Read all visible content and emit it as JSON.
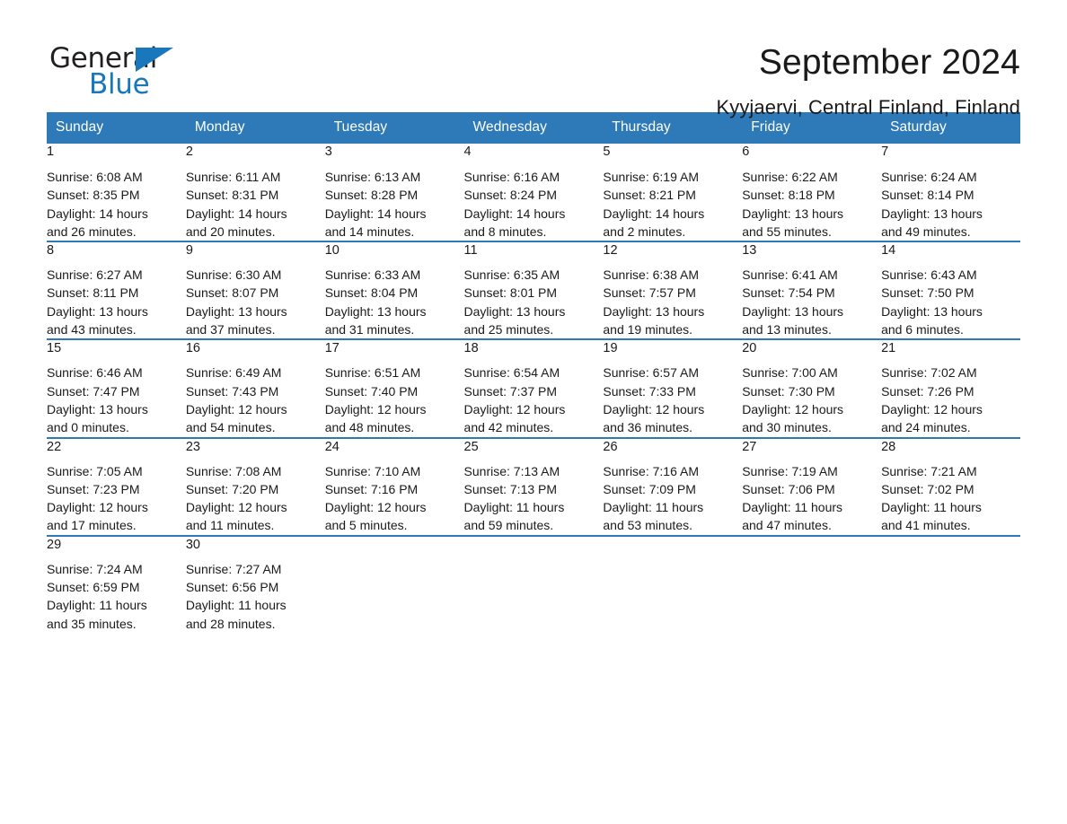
{
  "brand": {
    "name_part1": "General",
    "name_part2": "Blue",
    "accent_color": "#1877bd"
  },
  "header": {
    "title": "September 2024",
    "subtitle": "Kyyjaervi, Central Finland, Finland"
  },
  "colors": {
    "header_blue": "#2e7ab8",
    "daynum_band": "#f2f2f2",
    "text": "#1a1a1a"
  },
  "weekday_headers": [
    "Sunday",
    "Monday",
    "Tuesday",
    "Wednesday",
    "Thursday",
    "Friday",
    "Saturday"
  ],
  "weeks": [
    [
      {
        "day": "1",
        "sunrise": "Sunrise: 6:08 AM",
        "sunset": "Sunset: 8:35 PM",
        "daylight_1": "Daylight: 14 hours",
        "daylight_2": "and 26 minutes."
      },
      {
        "day": "2",
        "sunrise": "Sunrise: 6:11 AM",
        "sunset": "Sunset: 8:31 PM",
        "daylight_1": "Daylight: 14 hours",
        "daylight_2": "and 20 minutes."
      },
      {
        "day": "3",
        "sunrise": "Sunrise: 6:13 AM",
        "sunset": "Sunset: 8:28 PM",
        "daylight_1": "Daylight: 14 hours",
        "daylight_2": "and 14 minutes."
      },
      {
        "day": "4",
        "sunrise": "Sunrise: 6:16 AM",
        "sunset": "Sunset: 8:24 PM",
        "daylight_1": "Daylight: 14 hours",
        "daylight_2": "and 8 minutes."
      },
      {
        "day": "5",
        "sunrise": "Sunrise: 6:19 AM",
        "sunset": "Sunset: 8:21 PM",
        "daylight_1": "Daylight: 14 hours",
        "daylight_2": "and 2 minutes."
      },
      {
        "day": "6",
        "sunrise": "Sunrise: 6:22 AM",
        "sunset": "Sunset: 8:18 PM",
        "daylight_1": "Daylight: 13 hours",
        "daylight_2": "and 55 minutes."
      },
      {
        "day": "7",
        "sunrise": "Sunrise: 6:24 AM",
        "sunset": "Sunset: 8:14 PM",
        "daylight_1": "Daylight: 13 hours",
        "daylight_2": "and 49 minutes."
      }
    ],
    [
      {
        "day": "8",
        "sunrise": "Sunrise: 6:27 AM",
        "sunset": "Sunset: 8:11 PM",
        "daylight_1": "Daylight: 13 hours",
        "daylight_2": "and 43 minutes."
      },
      {
        "day": "9",
        "sunrise": "Sunrise: 6:30 AM",
        "sunset": "Sunset: 8:07 PM",
        "daylight_1": "Daylight: 13 hours",
        "daylight_2": "and 37 minutes."
      },
      {
        "day": "10",
        "sunrise": "Sunrise: 6:33 AM",
        "sunset": "Sunset: 8:04 PM",
        "daylight_1": "Daylight: 13 hours",
        "daylight_2": "and 31 minutes."
      },
      {
        "day": "11",
        "sunrise": "Sunrise: 6:35 AM",
        "sunset": "Sunset: 8:01 PM",
        "daylight_1": "Daylight: 13 hours",
        "daylight_2": "and 25 minutes."
      },
      {
        "day": "12",
        "sunrise": "Sunrise: 6:38 AM",
        "sunset": "Sunset: 7:57 PM",
        "daylight_1": "Daylight: 13 hours",
        "daylight_2": "and 19 minutes."
      },
      {
        "day": "13",
        "sunrise": "Sunrise: 6:41 AM",
        "sunset": "Sunset: 7:54 PM",
        "daylight_1": "Daylight: 13 hours",
        "daylight_2": "and 13 minutes."
      },
      {
        "day": "14",
        "sunrise": "Sunrise: 6:43 AM",
        "sunset": "Sunset: 7:50 PM",
        "daylight_1": "Daylight: 13 hours",
        "daylight_2": "and 6 minutes."
      }
    ],
    [
      {
        "day": "15",
        "sunrise": "Sunrise: 6:46 AM",
        "sunset": "Sunset: 7:47 PM",
        "daylight_1": "Daylight: 13 hours",
        "daylight_2": "and 0 minutes."
      },
      {
        "day": "16",
        "sunrise": "Sunrise: 6:49 AM",
        "sunset": "Sunset: 7:43 PM",
        "daylight_1": "Daylight: 12 hours",
        "daylight_2": "and 54 minutes."
      },
      {
        "day": "17",
        "sunrise": "Sunrise: 6:51 AM",
        "sunset": "Sunset: 7:40 PM",
        "daylight_1": "Daylight: 12 hours",
        "daylight_2": "and 48 minutes."
      },
      {
        "day": "18",
        "sunrise": "Sunrise: 6:54 AM",
        "sunset": "Sunset: 7:37 PM",
        "daylight_1": "Daylight: 12 hours",
        "daylight_2": "and 42 minutes."
      },
      {
        "day": "19",
        "sunrise": "Sunrise: 6:57 AM",
        "sunset": "Sunset: 7:33 PM",
        "daylight_1": "Daylight: 12 hours",
        "daylight_2": "and 36 minutes."
      },
      {
        "day": "20",
        "sunrise": "Sunrise: 7:00 AM",
        "sunset": "Sunset: 7:30 PM",
        "daylight_1": "Daylight: 12 hours",
        "daylight_2": "and 30 minutes."
      },
      {
        "day": "21",
        "sunrise": "Sunrise: 7:02 AM",
        "sunset": "Sunset: 7:26 PM",
        "daylight_1": "Daylight: 12 hours",
        "daylight_2": "and 24 minutes."
      }
    ],
    [
      {
        "day": "22",
        "sunrise": "Sunrise: 7:05 AM",
        "sunset": "Sunset: 7:23 PM",
        "daylight_1": "Daylight: 12 hours",
        "daylight_2": "and 17 minutes."
      },
      {
        "day": "23",
        "sunrise": "Sunrise: 7:08 AM",
        "sunset": "Sunset: 7:20 PM",
        "daylight_1": "Daylight: 12 hours",
        "daylight_2": "and 11 minutes."
      },
      {
        "day": "24",
        "sunrise": "Sunrise: 7:10 AM",
        "sunset": "Sunset: 7:16 PM",
        "daylight_1": "Daylight: 12 hours",
        "daylight_2": "and 5 minutes."
      },
      {
        "day": "25",
        "sunrise": "Sunrise: 7:13 AM",
        "sunset": "Sunset: 7:13 PM",
        "daylight_1": "Daylight: 11 hours",
        "daylight_2": "and 59 minutes."
      },
      {
        "day": "26",
        "sunrise": "Sunrise: 7:16 AM",
        "sunset": "Sunset: 7:09 PM",
        "daylight_1": "Daylight: 11 hours",
        "daylight_2": "and 53 minutes."
      },
      {
        "day": "27",
        "sunrise": "Sunrise: 7:19 AM",
        "sunset": "Sunset: 7:06 PM",
        "daylight_1": "Daylight: 11 hours",
        "daylight_2": "and 47 minutes."
      },
      {
        "day": "28",
        "sunrise": "Sunrise: 7:21 AM",
        "sunset": "Sunset: 7:02 PM",
        "daylight_1": "Daylight: 11 hours",
        "daylight_2": "and 41 minutes."
      }
    ],
    [
      {
        "day": "29",
        "sunrise": "Sunrise: 7:24 AM",
        "sunset": "Sunset: 6:59 PM",
        "daylight_1": "Daylight: 11 hours",
        "daylight_2": "and 35 minutes."
      },
      {
        "day": "30",
        "sunrise": "Sunrise: 7:27 AM",
        "sunset": "Sunset: 6:56 PM",
        "daylight_1": "Daylight: 11 hours",
        "daylight_2": "and 28 minutes."
      },
      {
        "day": "",
        "sunrise": "",
        "sunset": "",
        "daylight_1": "",
        "daylight_2": ""
      },
      {
        "day": "",
        "sunrise": "",
        "sunset": "",
        "daylight_1": "",
        "daylight_2": ""
      },
      {
        "day": "",
        "sunrise": "",
        "sunset": "",
        "daylight_1": "",
        "daylight_2": ""
      },
      {
        "day": "",
        "sunrise": "",
        "sunset": "",
        "daylight_1": "",
        "daylight_2": ""
      },
      {
        "day": "",
        "sunrise": "",
        "sunset": "",
        "daylight_1": "",
        "daylight_2": ""
      }
    ]
  ]
}
